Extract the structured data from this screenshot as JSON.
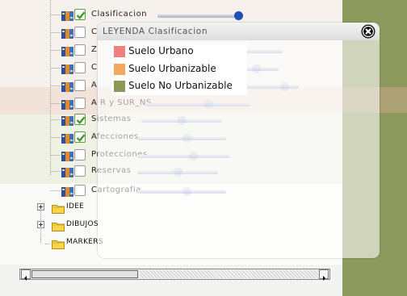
{
  "colors": {
    "suelo_urbano": "#f08080",
    "suelo_urbanizable": "#f5a85c",
    "suelo_no_urbanizable": "#8b9a5b",
    "slider_knob": "#1f4fb5",
    "checkbox_check": "#3f9a2c"
  },
  "layers": [
    {
      "label": "Clasificacion",
      "checked": true,
      "opacity": 1.0
    },
    {
      "label": "C",
      "checked": false,
      "opacity": 0.9
    },
    {
      "label": "Z",
      "checked": false,
      "opacity": 0.75
    },
    {
      "label": "C",
      "checked": false,
      "opacity": 0.85
    },
    {
      "label": "A",
      "checked": false,
      "opacity": 0.92
    },
    {
      "label": "A R y SUR_NS",
      "checked": false,
      "opacity": 0.6
    },
    {
      "label": "Sistemas",
      "checked": true,
      "opacity": 0.5
    },
    {
      "label": "Afecciones",
      "checked": true,
      "opacity": 0.55
    },
    {
      "label": "Protecciones",
      "checked": false,
      "opacity": 0.6
    },
    {
      "label": "Reservas",
      "checked": false,
      "opacity": 0.5
    },
    {
      "label": "Cartografia",
      "checked": false,
      "opacity": 0.55
    }
  ],
  "folders": [
    {
      "label": "IDEE",
      "expandable": true
    },
    {
      "label": "DIBUJOS",
      "expandable": true
    },
    {
      "label": "MARKERS",
      "expandable": false
    }
  ],
  "legend": {
    "title": "LEYENDA Clasificacion",
    "items": [
      {
        "label": "Suelo Urbano",
        "color_key": "suelo_urbano"
      },
      {
        "label": "Suelo Urbanizable",
        "color_key": "suelo_urbanizable"
      },
      {
        "label": "Suelo No Urbanizable",
        "color_key": "suelo_no_urbanizable"
      }
    ]
  },
  "icons": {
    "layer": "layer-stack-icon",
    "folder": "folder-icon",
    "close": "close-icon",
    "arrow_left": "arrow-left-icon",
    "arrow_right": "arrow-right-icon"
  }
}
